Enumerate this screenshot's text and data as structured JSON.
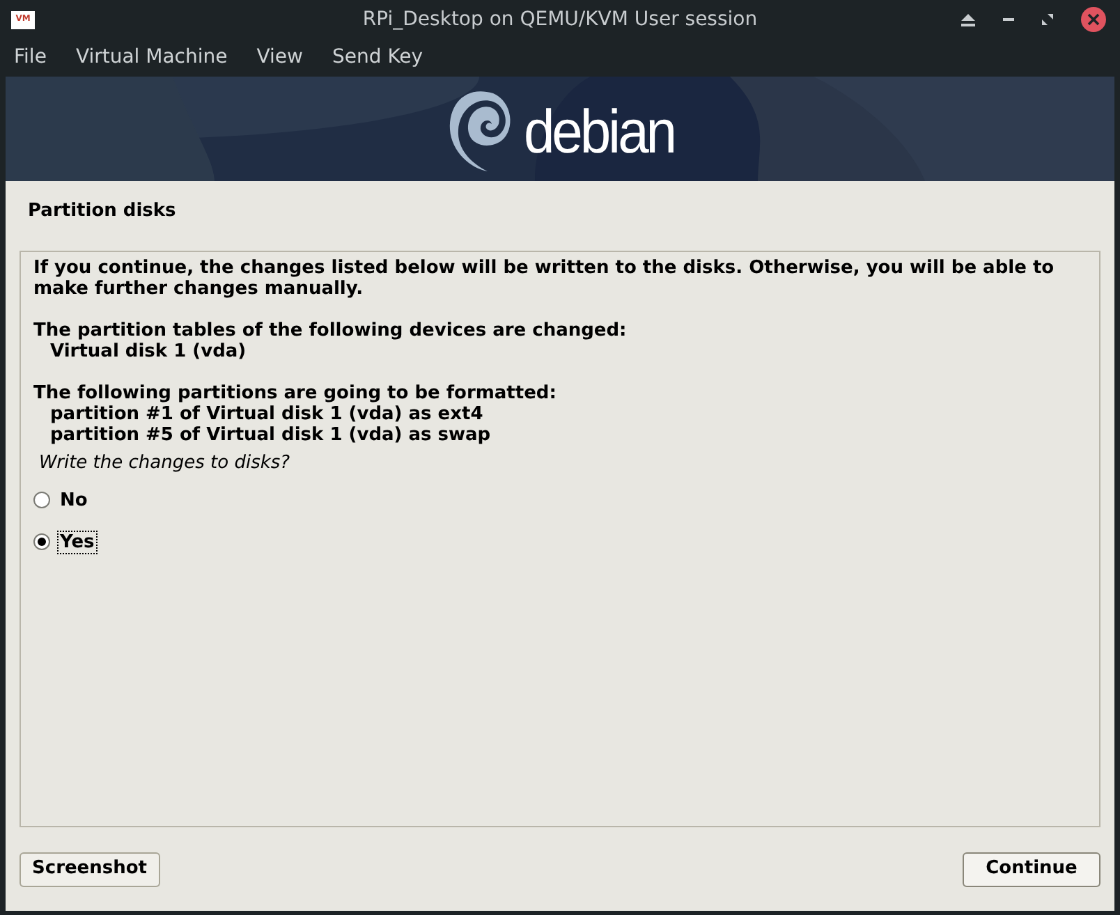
{
  "window": {
    "title": "RPi_Desktop on QEMU/KVM User session",
    "app_icon": "VM"
  },
  "menu": [
    "File",
    "Virtual Machine",
    "View",
    "Send Key"
  ],
  "banner": {
    "logo_text": "debian"
  },
  "page_title": "Partition disks",
  "intro": "If you continue, the changes listed below will be written to the disks. Otherwise, you will be able to make further changes manually.",
  "sections": [
    {
      "heading": "The partition tables of the following devices are changed:",
      "items": [
        "Virtual disk 1 (vda)"
      ]
    },
    {
      "heading": "The following partitions are going to be formatted:",
      "items": [
        "partition #1 of Virtual disk 1 (vda) as ext4",
        "partition #5 of Virtual disk 1 (vda) as swap"
      ]
    }
  ],
  "question": "Write the changes to disks?",
  "options": [
    {
      "label": "No",
      "selected": false
    },
    {
      "label": "Yes",
      "selected": true
    }
  ],
  "buttons": {
    "left": "Screenshot",
    "right": "Continue"
  }
}
